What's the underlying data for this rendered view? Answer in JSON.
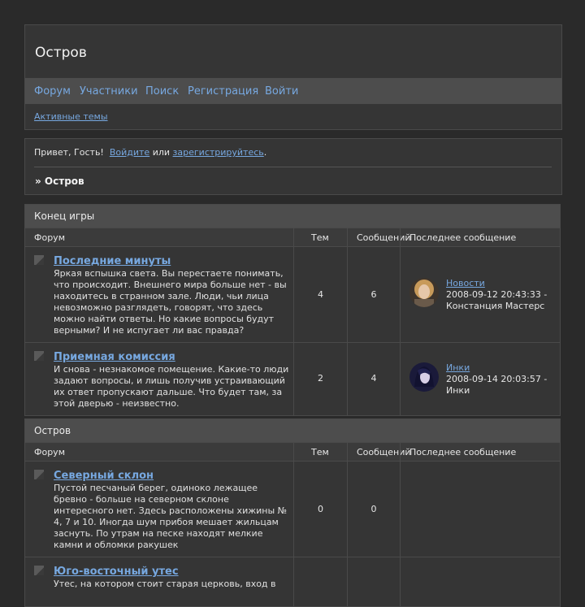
{
  "site": {
    "title": "Остров"
  },
  "nav": {
    "items": [
      "Форум",
      "Участники",
      "Поиск",
      "Регистрация",
      "Войти"
    ],
    "active_topics": "Активные темы"
  },
  "welcome": {
    "greeting": "Привет, Гость!",
    "login_link": "Войдите",
    "or": "или",
    "register_link": "зарегистрируйтесь",
    "period": ".",
    "breadcrumb": "» Остров"
  },
  "columns": {
    "forum": "Форум",
    "topics": "Тем",
    "posts": "Сообщений",
    "last_post": "Последнее сообщение"
  },
  "categories": [
    {
      "title": "Конец игры",
      "forums": [
        {
          "name": "Последние минуты",
          "description": "Яркая вспышка света. Вы перестаете понимать, что происходит. Внешнего мира больше нет - вы находитесь в странном зале. Люди, чьи лица невозможно разглядеть, говорят, что здесь можно найти ответы. Но какие вопросы будут верными? И не испугает ли вас правда?",
          "topics": "4",
          "posts": "6",
          "last_post": {
            "link": "Новости",
            "meta": "2008-09-12 20:43:33 - Констанция Мастерс",
            "avatar": "woman-avatar"
          }
        },
        {
          "name": "Приемная комиссия",
          "description": "И снова - незнакомое помещение. Какие-то люди задают вопросы, и лишь получив устраивающий их ответ пропускают дальше. Что будет там, за этой дверью - неизвестно.",
          "topics": "2",
          "posts": "4",
          "last_post": {
            "link": "Инки",
            "meta": "2008-09-14 20:03:57 - Инки",
            "avatar": "dark-haired-avatar"
          }
        }
      ]
    },
    {
      "title": "Остров",
      "forums": [
        {
          "name": "Северный склон",
          "description": "Пустой песчаный берег, одиноко лежащее бревно - больше на северном склоне интересного нет. Здесь расположены хижины № 4, 7 и 10. Иногда шум прибоя мешает жильцам заснуть. По утрам на песке находят мелкие камни и обломки ракушек",
          "topics": "0",
          "posts": "0"
        },
        {
          "name": "Юго-восточный утес",
          "description": "Утес, на котором стоит старая церковь, вход в"
        }
      ]
    }
  ]
}
